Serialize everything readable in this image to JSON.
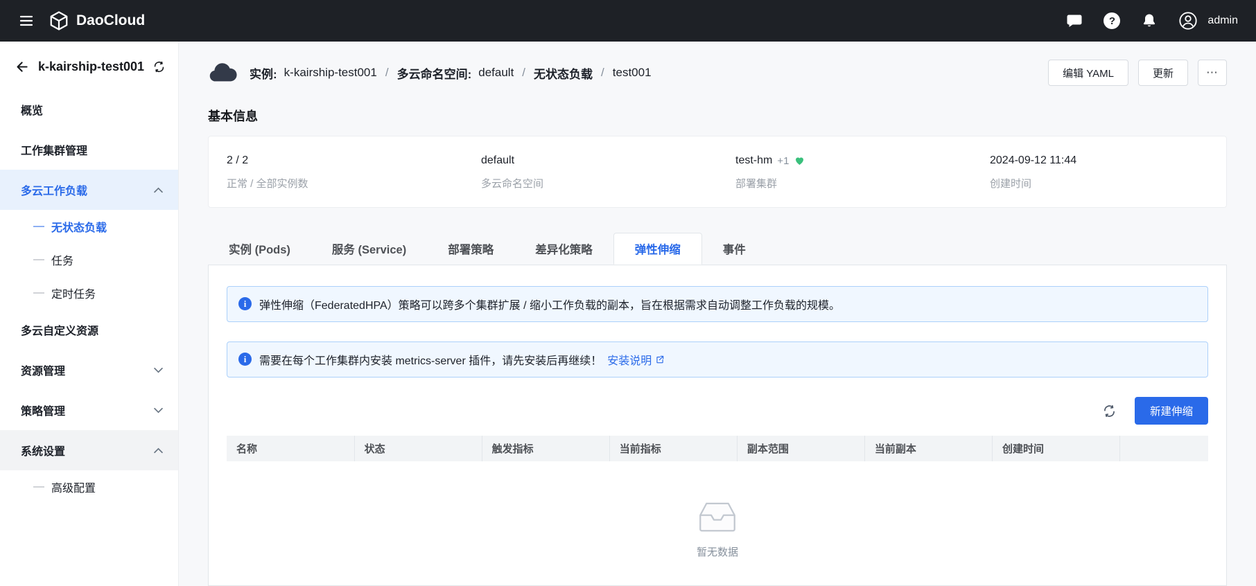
{
  "colors": {
    "topbar_bg": "#1e2126",
    "primary": "#2a6ae9",
    "success_heart": "#3ac07c",
    "alert_bg": "#f0f7ff",
    "alert_border": "#abd0fa",
    "sidebar_active_bg": "#e8f1fd"
  },
  "topbar": {
    "brand": "DaoCloud",
    "user": "admin"
  },
  "sidebar": {
    "title": "k-kairship-test001",
    "items": [
      {
        "label": "概览"
      },
      {
        "label": "工作集群管理"
      },
      {
        "label": "多云工作负载"
      },
      {
        "label": "无状态负载"
      },
      {
        "label": "任务"
      },
      {
        "label": "定时任务"
      },
      {
        "label": "多云自定义资源"
      },
      {
        "label": "资源管理"
      },
      {
        "label": "策略管理"
      },
      {
        "label": "系统设置"
      },
      {
        "label": "高级配置"
      }
    ]
  },
  "header": {
    "instance_label": "实例:",
    "instance": "k-kairship-test001",
    "namespace_label": "多云命名空间:",
    "namespace": "default",
    "workload": "无状态负载",
    "name": "test001",
    "separator": "/",
    "edit_yaml": "编辑 YAML",
    "update": "更新",
    "more": "⋯"
  },
  "basic_info": {
    "title": "基本信息",
    "stats": [
      {
        "value": "2 / 2",
        "label": "正常 / 全部实例数"
      },
      {
        "value": "default",
        "label": "多云命名空间"
      },
      {
        "value": "test-hm",
        "extra": "+1",
        "label": "部署集群"
      },
      {
        "value": "2024-09-12 11:44",
        "label": "创建时间"
      }
    ]
  },
  "tabs": [
    {
      "label": "实例 (Pods)"
    },
    {
      "label": "服务 (Service)"
    },
    {
      "label": "部署策略"
    },
    {
      "label": "差异化策略"
    },
    {
      "label": "弹性伸缩"
    },
    {
      "label": "事件"
    }
  ],
  "panel": {
    "alerts": [
      {
        "text": "弹性伸缩（FederatedHPA）策略可以跨多个集群扩展 / 缩小工作负载的副本，旨在根据需求自动调整工作负载的规模。"
      },
      {
        "text": "需要在每个工作集群内安装 metrics-server 插件，请先安装后再继续！",
        "link": "安装说明"
      }
    ],
    "create_button": "新建伸缩",
    "table": {
      "columns": [
        "名称",
        "状态",
        "触发指标",
        "当前指标",
        "副本范围",
        "当前副本",
        "创建时间"
      ],
      "empty_text": "暂无数据"
    }
  }
}
